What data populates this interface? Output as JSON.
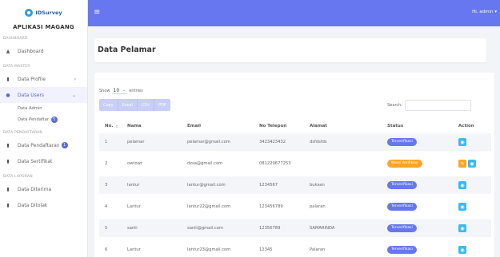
{
  "sidebar": {
    "logo_text": "IDSurvey",
    "app_title": "APLIKASI MAGANG",
    "sections": {
      "dashboard": "DASHBOARD",
      "master": "DATA MASTER",
      "pendaftaran": "DATA PENDAFTARAN",
      "laporan": "DATA LAPORAN"
    },
    "items": {
      "dashboard": "Dashboard",
      "data_profile": "Data Profile",
      "data_users": "Data Users",
      "data_admin": "Data Admin",
      "data_pendaftar": "Data Pendaftar",
      "data_pendaftar_badge": "5",
      "data_pendaftaran": "Data Pendaftaran",
      "data_pendaftaran_badge": "1",
      "data_sertifikat": "Data Sertifikat",
      "data_diterima": "Data Diterima",
      "data_ditolak": "Data Ditolak"
    }
  },
  "topbar": {
    "greeting": "Hi, admin"
  },
  "page": {
    "title": "Data Pelamar"
  },
  "table_controls": {
    "show_label": "Show",
    "entries_value": "10",
    "entries_label": "entries",
    "buttons": [
      "Copy",
      "Excel",
      "CSV",
      "PDF"
    ],
    "search_label": "Search:"
  },
  "table": {
    "headers": [
      "No.",
      "Nama",
      "Email",
      "No Telepon",
      "Alamat",
      "Status",
      "Action"
    ],
    "rows": [
      {
        "no": "1",
        "nama": "pelamar",
        "email": "pelamar@gmail.com",
        "telp": "3423423432",
        "alamat": "dsfdsfds",
        "status": "Terverifikasi",
        "status_type": "ok",
        "edit": false
      },
      {
        "no": "2",
        "nama": "owtowr",
        "email": "dzsa@gmail.com",
        "telp": "081229677253",
        "alamat": "",
        "status": "Need Verifikasi",
        "status_type": "need",
        "edit": true
      },
      {
        "no": "3",
        "nama": "lantur",
        "email": "lantur@gmail.com",
        "telp": "1234567",
        "alamat": "buksan",
        "status": "Terverifikasi",
        "status_type": "ok",
        "edit": false
      },
      {
        "no": "4",
        "nama": "Lantur",
        "email": "lantur22@gmail.com",
        "telp": "123456789",
        "alamat": "palaran",
        "status": "Terverifikasi",
        "status_type": "ok",
        "edit": false
      },
      {
        "no": "5",
        "nama": "santi",
        "email": "santi@gmail.com",
        "telp": "12356789",
        "alamat": "SAMARINDA",
        "status": "Terverifikasi",
        "status_type": "ok",
        "edit": false
      },
      {
        "no": "6",
        "nama": "Lantur",
        "email": "lantur23@gmail.com",
        "telp": "12345",
        "alamat": "Palaran",
        "status": "Terverifikasi",
        "status_type": "ok",
        "edit": false
      }
    ]
  },
  "colors": {
    "accent": "#6777ef",
    "info": "#3abaf4",
    "warning": "#ffa426"
  }
}
